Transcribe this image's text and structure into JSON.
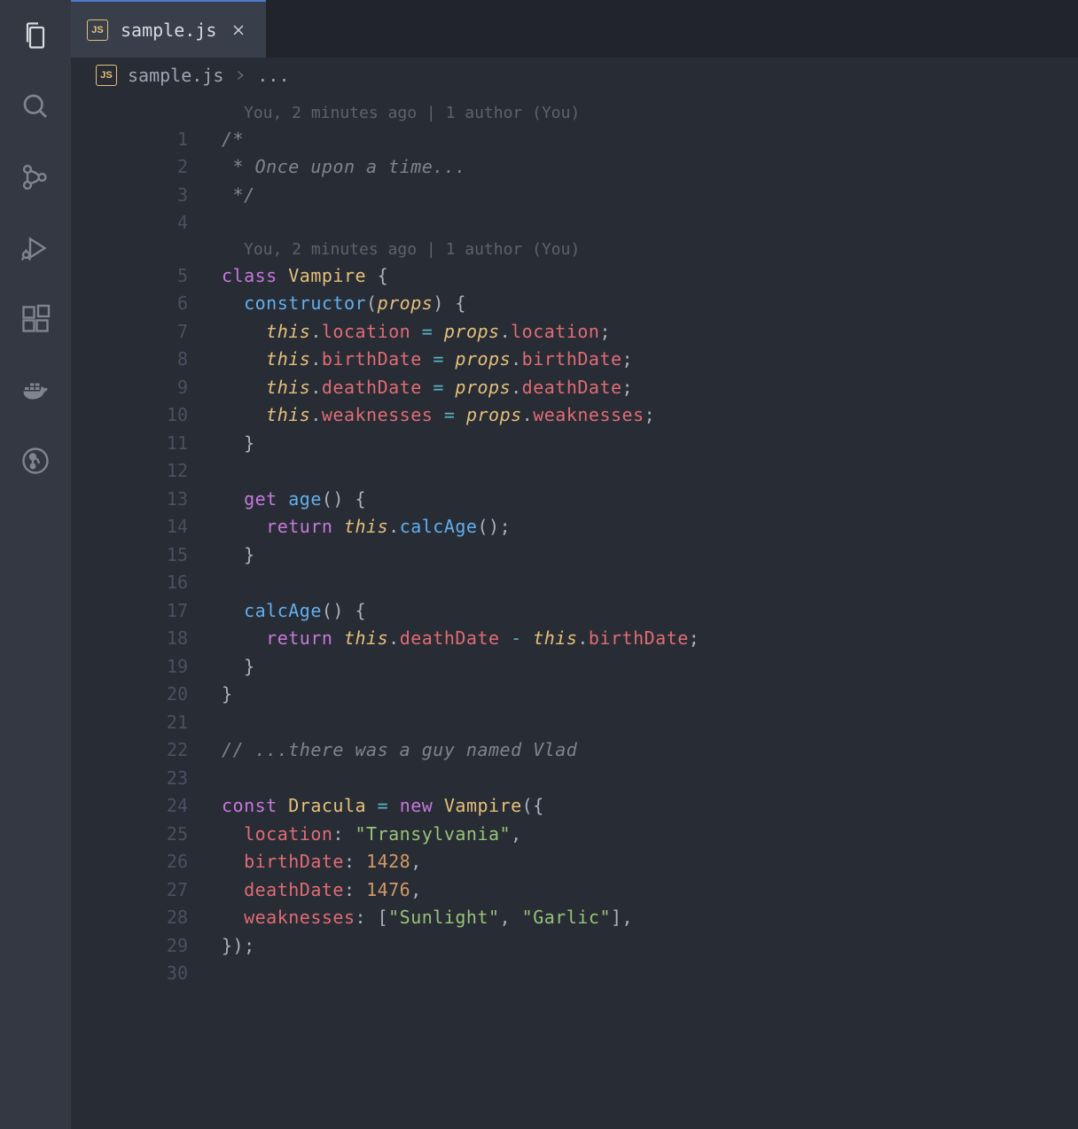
{
  "activityBar": {
    "items": [
      "explorer",
      "search",
      "source-control",
      "run-debug",
      "extensions",
      "docker",
      "gitlens"
    ]
  },
  "tab": {
    "icon_label": "JS",
    "filename": "sample.js"
  },
  "breadcrumb": {
    "icon_label": "JS",
    "filename": "sample.js",
    "rest": "..."
  },
  "codelens": {
    "top": "You, 2 minutes ago | 1 author (You)",
    "class": "You, 2 minutes ago | 1 author (You)"
  },
  "code": {
    "l1": {
      "n": "1",
      "tokens": [
        {
          "t": "/*",
          "c": "c-comment"
        }
      ]
    },
    "l2": {
      "n": "2",
      "tokens": [
        {
          "t": " * Once upon a time...",
          "c": "c-comment"
        }
      ]
    },
    "l3": {
      "n": "3",
      "tokens": [
        {
          "t": " */",
          "c": "c-comment"
        }
      ]
    },
    "l4": {
      "n": "4",
      "tokens": []
    },
    "l5": {
      "n": "5",
      "tokens": [
        {
          "t": "class ",
          "c": "c-keyword"
        },
        {
          "t": "Vampire ",
          "c": "c-class"
        },
        {
          "t": "{",
          "c": "c-punct"
        }
      ]
    },
    "l6": {
      "n": "6",
      "tokens": [
        {
          "t": "  ",
          "c": ""
        },
        {
          "t": "constructor",
          "c": "c-func"
        },
        {
          "t": "(",
          "c": "c-punct"
        },
        {
          "t": "props",
          "c": "c-param"
        },
        {
          "t": ") {",
          "c": "c-punct"
        }
      ]
    },
    "l7": {
      "n": "7",
      "tokens": [
        {
          "t": "    ",
          "c": ""
        },
        {
          "t": "this",
          "c": "c-this"
        },
        {
          "t": ".",
          "c": "c-punct"
        },
        {
          "t": "location",
          "c": "c-prop"
        },
        {
          "t": " ",
          "c": ""
        },
        {
          "t": "=",
          "c": "c-op"
        },
        {
          "t": " ",
          "c": ""
        },
        {
          "t": "props",
          "c": "c-param"
        },
        {
          "t": ".",
          "c": "c-punct"
        },
        {
          "t": "location",
          "c": "c-prop"
        },
        {
          "t": ";",
          "c": "c-punct"
        }
      ]
    },
    "l8": {
      "n": "8",
      "tokens": [
        {
          "t": "    ",
          "c": ""
        },
        {
          "t": "this",
          "c": "c-this"
        },
        {
          "t": ".",
          "c": "c-punct"
        },
        {
          "t": "birthDate",
          "c": "c-prop"
        },
        {
          "t": " ",
          "c": ""
        },
        {
          "t": "=",
          "c": "c-op"
        },
        {
          "t": " ",
          "c": ""
        },
        {
          "t": "props",
          "c": "c-param"
        },
        {
          "t": ".",
          "c": "c-punct"
        },
        {
          "t": "birthDate",
          "c": "c-prop"
        },
        {
          "t": ";",
          "c": "c-punct"
        }
      ]
    },
    "l9": {
      "n": "9",
      "tokens": [
        {
          "t": "    ",
          "c": ""
        },
        {
          "t": "this",
          "c": "c-this"
        },
        {
          "t": ".",
          "c": "c-punct"
        },
        {
          "t": "deathDate",
          "c": "c-prop"
        },
        {
          "t": " ",
          "c": ""
        },
        {
          "t": "=",
          "c": "c-op"
        },
        {
          "t": " ",
          "c": ""
        },
        {
          "t": "props",
          "c": "c-param"
        },
        {
          "t": ".",
          "c": "c-punct"
        },
        {
          "t": "deathDate",
          "c": "c-prop"
        },
        {
          "t": ";",
          "c": "c-punct"
        }
      ]
    },
    "l10": {
      "n": "10",
      "tokens": [
        {
          "t": "    ",
          "c": ""
        },
        {
          "t": "this",
          "c": "c-this"
        },
        {
          "t": ".",
          "c": "c-punct"
        },
        {
          "t": "weaknesses",
          "c": "c-prop"
        },
        {
          "t": " ",
          "c": ""
        },
        {
          "t": "=",
          "c": "c-op"
        },
        {
          "t": " ",
          "c": ""
        },
        {
          "t": "props",
          "c": "c-param"
        },
        {
          "t": ".",
          "c": "c-punct"
        },
        {
          "t": "weaknesses",
          "c": "c-prop"
        },
        {
          "t": ";",
          "c": "c-punct"
        }
      ]
    },
    "l11": {
      "n": "11",
      "tokens": [
        {
          "t": "  }",
          "c": "c-punct"
        }
      ]
    },
    "l12": {
      "n": "12",
      "tokens": []
    },
    "l13": {
      "n": "13",
      "tokens": [
        {
          "t": "  ",
          "c": ""
        },
        {
          "t": "get ",
          "c": "c-keyword"
        },
        {
          "t": "age",
          "c": "c-func"
        },
        {
          "t": "() {",
          "c": "c-punct"
        }
      ]
    },
    "l14": {
      "n": "14",
      "tokens": [
        {
          "t": "    ",
          "c": ""
        },
        {
          "t": "return ",
          "c": "c-keyword"
        },
        {
          "t": "this",
          "c": "c-this"
        },
        {
          "t": ".",
          "c": "c-punct"
        },
        {
          "t": "calcAge",
          "c": "c-func"
        },
        {
          "t": "();",
          "c": "c-punct"
        }
      ]
    },
    "l15": {
      "n": "15",
      "tokens": [
        {
          "t": "  }",
          "c": "c-punct"
        }
      ]
    },
    "l16": {
      "n": "16",
      "tokens": []
    },
    "l17": {
      "n": "17",
      "tokens": [
        {
          "t": "  ",
          "c": ""
        },
        {
          "t": "calcAge",
          "c": "c-func"
        },
        {
          "t": "() {",
          "c": "c-punct"
        }
      ]
    },
    "l18": {
      "n": "18",
      "tokens": [
        {
          "t": "    ",
          "c": ""
        },
        {
          "t": "return ",
          "c": "c-keyword"
        },
        {
          "t": "this",
          "c": "c-this"
        },
        {
          "t": ".",
          "c": "c-punct"
        },
        {
          "t": "deathDate",
          "c": "c-prop"
        },
        {
          "t": " ",
          "c": ""
        },
        {
          "t": "-",
          "c": "c-op"
        },
        {
          "t": " ",
          "c": ""
        },
        {
          "t": "this",
          "c": "c-this"
        },
        {
          "t": ".",
          "c": "c-punct"
        },
        {
          "t": "birthDate",
          "c": "c-prop"
        },
        {
          "t": ";",
          "c": "c-punct"
        }
      ]
    },
    "l19": {
      "n": "19",
      "tokens": [
        {
          "t": "  }",
          "c": "c-punct"
        }
      ]
    },
    "l20": {
      "n": "20",
      "tokens": [
        {
          "t": "}",
          "c": "c-punct"
        }
      ]
    },
    "l21": {
      "n": "21",
      "tokens": []
    },
    "l22": {
      "n": "22",
      "tokens": [
        {
          "t": "// ...there was a guy named Vlad",
          "c": "c-comment"
        }
      ]
    },
    "l23": {
      "n": "23",
      "tokens": []
    },
    "l24": {
      "n": "24",
      "tokens": [
        {
          "t": "const ",
          "c": "c-keyword"
        },
        {
          "t": "Dracula",
          "c": "c-const"
        },
        {
          "t": " ",
          "c": ""
        },
        {
          "t": "=",
          "c": "c-op"
        },
        {
          "t": " ",
          "c": ""
        },
        {
          "t": "new ",
          "c": "c-keyword"
        },
        {
          "t": "Vampire",
          "c": "c-class"
        },
        {
          "t": "({",
          "c": "c-punct"
        }
      ]
    },
    "l25": {
      "n": "25",
      "tokens": [
        {
          "t": "  ",
          "c": ""
        },
        {
          "t": "location",
          "c": "c-prop"
        },
        {
          "t": ": ",
          "c": "c-punct"
        },
        {
          "t": "\"Transylvania\"",
          "c": "c-str"
        },
        {
          "t": ",",
          "c": "c-punct"
        }
      ]
    },
    "l26": {
      "n": "26",
      "tokens": [
        {
          "t": "  ",
          "c": ""
        },
        {
          "t": "birthDate",
          "c": "c-prop"
        },
        {
          "t": ": ",
          "c": "c-punct"
        },
        {
          "t": "1428",
          "c": "c-num"
        },
        {
          "t": ",",
          "c": "c-punct"
        }
      ]
    },
    "l27": {
      "n": "27",
      "tokens": [
        {
          "t": "  ",
          "c": ""
        },
        {
          "t": "deathDate",
          "c": "c-prop"
        },
        {
          "t": ": ",
          "c": "c-punct"
        },
        {
          "t": "1476",
          "c": "c-num"
        },
        {
          "t": ",",
          "c": "c-punct"
        }
      ]
    },
    "l28": {
      "n": "28",
      "tokens": [
        {
          "t": "  ",
          "c": ""
        },
        {
          "t": "weaknesses",
          "c": "c-prop"
        },
        {
          "t": ": [",
          "c": "c-punct"
        },
        {
          "t": "\"Sunlight\"",
          "c": "c-str"
        },
        {
          "t": ", ",
          "c": "c-punct"
        },
        {
          "t": "\"Garlic\"",
          "c": "c-str"
        },
        {
          "t": "],",
          "c": "c-punct"
        }
      ]
    },
    "l29": {
      "n": "29",
      "tokens": [
        {
          "t": "});",
          "c": "c-punct"
        }
      ]
    },
    "l30": {
      "n": "30",
      "tokens": []
    }
  }
}
